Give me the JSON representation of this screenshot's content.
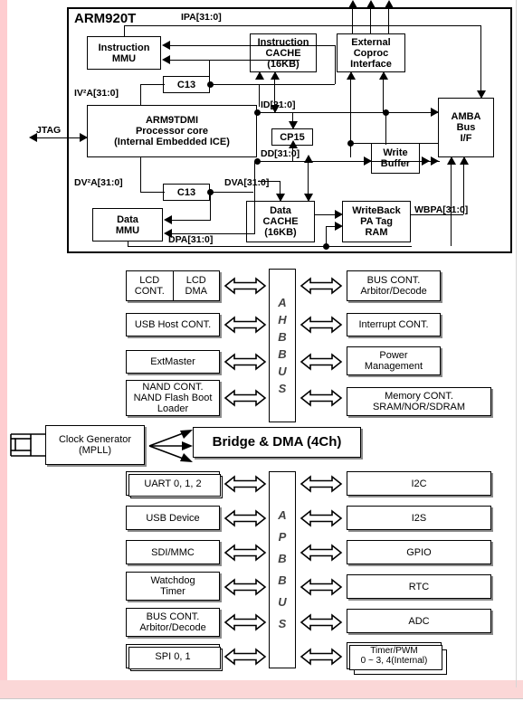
{
  "diagram": {
    "title": "ARM920T",
    "cpu_block": {
      "instruction_mmu": "Instruction\nMMU",
      "instruction_cache": "Instruction\nCACHE\n(16KB)",
      "external_coproc": "External\nCoproc\nInterface",
      "core": "ARM9TDMI\nProcessor core\n(Internal Embedded ICE)",
      "amba": "AMBA\nBus\nI/F",
      "write_buffer": "Write\nBuffer",
      "data_mmu": "Data\nMMU",
      "data_cache": "Data\nCACHE\n(16KB)",
      "writeback": "WriteBack\nPA Tag\nRAM",
      "c13_top": "C13",
      "c13_bottom": "C13",
      "cp15": "CP15"
    },
    "bus_labels": {
      "ipa": "IPA[31:0]",
      "iva": "IV²A[31:0]",
      "id": "ID[31:0]",
      "dd": "DD[31:0]",
      "dva2": "DV²A[31:0]",
      "dva": "DVA[31:0]",
      "dpa": "DPA[31:0]",
      "wbpa": "WBPA[31:0]",
      "jtag": "JTAG"
    },
    "ahb": {
      "bus_name": "AHB BUS",
      "bus_letters": [
        "A",
        "H",
        "B",
        "B",
        "U",
        "S"
      ],
      "left_masters": [
        {
          "label": "LCD\nCONT.",
          "label2": "LCD\nDMA",
          "split": true
        },
        {
          "label": "USB Host CONT."
        },
        {
          "label": "ExtMaster"
        },
        {
          "label": "NAND CONT.\nNAND Flash Boot\nLoader"
        }
      ],
      "right_slaves": [
        {
          "label": "BUS CONT.\nArbitor/Decode"
        },
        {
          "label": "Interrupt CONT."
        },
        {
          "label": "Power\nManagement"
        },
        {
          "label": "Memory CONT.\nSRAM/NOR/SDRAM"
        }
      ]
    },
    "clock": {
      "label": "Clock Generator\n(MPLL)",
      "crystal_icon": "crystal-oscillator-icon"
    },
    "bridge": {
      "label": "Bridge & DMA (4Ch)"
    },
    "apb": {
      "bus_name": "APB BUS",
      "bus_letters": [
        "A",
        "P",
        "B",
        "B",
        "U",
        "S"
      ],
      "left_peripherals": [
        {
          "label": "UART 0, 1, 2",
          "stacked": true
        },
        {
          "label": "USB Device",
          "stacked": false
        },
        {
          "label": "SDI/MMC",
          "stacked": false
        },
        {
          "label": "Watchdog\nTimer",
          "stacked": false
        },
        {
          "label": "BUS CONT.\nArbitor/Decode",
          "stacked": false
        },
        {
          "label": "SPI 0, 1",
          "stacked": true
        }
      ],
      "right_peripherals": [
        {
          "label": "I2C",
          "stacked": false
        },
        {
          "label": "I2S",
          "stacked": false
        },
        {
          "label": "GPIO",
          "stacked": false
        },
        {
          "label": "RTC",
          "stacked": false
        },
        {
          "label": "ADC",
          "stacked": false
        },
        {
          "label": "Timer/PWM\n0 ~ 3, 4(Internal)",
          "stacked": true
        }
      ]
    },
    "colors": {
      "line": "#000000",
      "box_fill": "#ffffff",
      "page_edge": "#fecdd0",
      "shadow": "#8a8a8a"
    }
  }
}
